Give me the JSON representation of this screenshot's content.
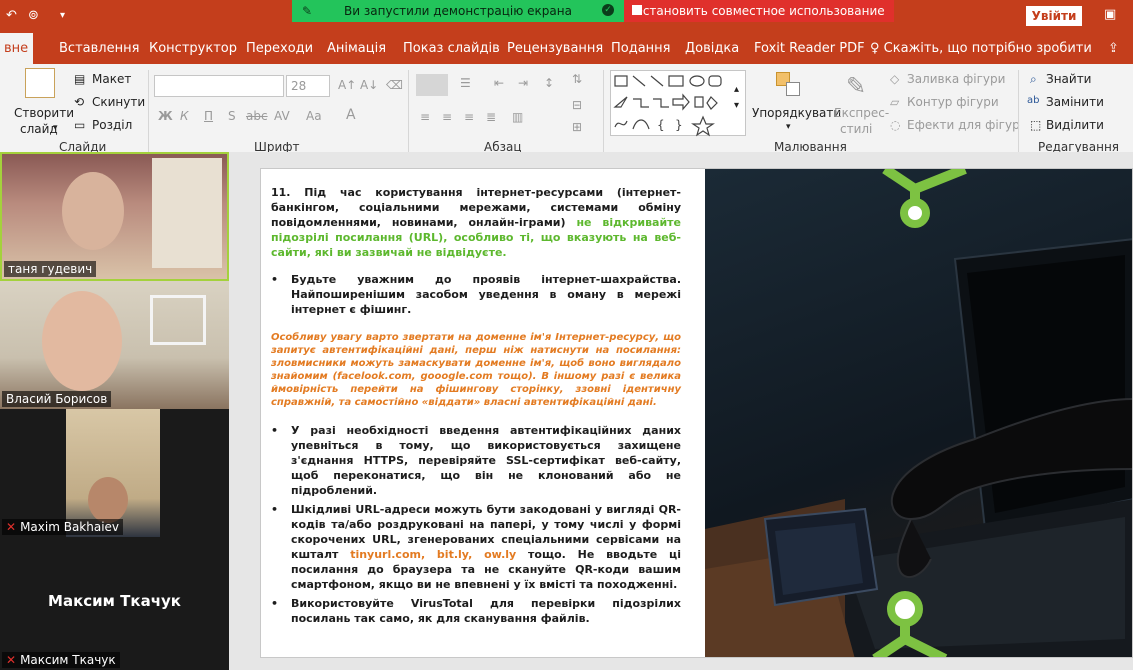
{
  "window": {
    "signin_label": "Увійти"
  },
  "share": {
    "running_text": "Ви запустили демонстрацію екрана",
    "stop_text": "Остановить совместное использование"
  },
  "tabs": [
    {
      "label": "вне"
    },
    {
      "label": "Вставлення"
    },
    {
      "label": "Конструктор"
    },
    {
      "label": "Переходи"
    },
    {
      "label": "Анімація"
    },
    {
      "label": "Показ слайдів"
    },
    {
      "label": "Рецензування"
    },
    {
      "label": "Подання"
    },
    {
      "label": "Довідка"
    },
    {
      "label": "Foxit Reader PDF"
    },
    {
      "label": "Скажіть, що потрібно зробити"
    }
  ],
  "ribbon": {
    "slides": {
      "create_line1": "Створити",
      "create_line2": "слайд",
      "layout": "Макет",
      "reset": "Скинути",
      "section": "Розділ",
      "group_label": "Слайди"
    },
    "font": {
      "size_value": "28",
      "bold": "Ж",
      "italic": "К",
      "underline": "П",
      "shadow": "S",
      "strike": "abc",
      "spacing": "AV",
      "case": "Aa",
      "group_label": "Шрифт"
    },
    "paragraph": {
      "group_label": "Абзац"
    },
    "drawing": {
      "arrange": "Упорядкувати",
      "quick_styles_line1": "Експрес-",
      "quick_styles_line2": "стилі",
      "shape_fill": "Заливка фігури",
      "shape_outline": "Контур фігури",
      "shape_effects": "Ефекти для фігур",
      "group_label": "Малювання"
    },
    "editing": {
      "find": "Знайти",
      "replace": "Замінити",
      "select": "Виділити",
      "group_label": "Редагування"
    }
  },
  "participants": [
    {
      "name": "таня гудевич"
    },
    {
      "name": "Власий Борисов"
    },
    {
      "name": "Maxim Bakhaiev"
    },
    {
      "name": "Максим Ткачук",
      "display": "Максим Ткачук"
    }
  ],
  "slide": {
    "p1_main": "11. Під час користування інтернет-ресурсами (інтернет-банкінгом, соціальними мережами, системами обміну повідомленнями, новинами, онлайн-іграми)",
    "p1_green": "не відкривайте підозрілі посилання (URL), особливо ті, що вказують на веб-сайти, які ви зазвичай не відвідуєте.",
    "b1": "Будьте уважним до проявів інтернет-шахрайства. Найпоширенішим засобом уведення в оману в мережі інтернет є фішинг.",
    "italic": "Особливу увагу варто звертати на доменне ім'я Інтернет-ресурсу, що запитує автентифікаційні дані, перш ніж натиснути на посилання: зловмисники можуть замаскувати доменне ім'я, щоб воно виглядало знайомим (facelook.com, gooogle.com тощо). В іншому разі є велика ймовірність перейти на фішингову сторінку, ззовні ідентичну справжній, та самостійно «віддати» власні автентифікаційні дані.",
    "b2": "У разі необхідності введення автентифікаційних даних упевніться в тому, що використовується захищене з'єднання HTTPS, перевіряйте SSL-сертифікат веб-сайту, щоб переконатися, що він не клонований або не підроблений.",
    "b3_a": "Шкідливі URL-адреси можуть бути закодовані у вигляді QR-кодів та/або роздруковані на папері, у тому числі у формі скорочених URL, згенерованих спеціальними сервісами на кшталт",
    "b3_links": "tinyurl.com, bit.ly, ow.ly",
    "b3_b": "тощо. Не вводьте ці посилання до браузера та не скануйте QR-коди вашим смартфоном, якщо ви не впевнені у їх вмісті та походженні.",
    "b4_a": "Використовуйте",
    "b4_brand": "VirusTotal",
    "b4_b": "для перевірки підозрілих посилань так само, як для сканування файлів."
  }
}
